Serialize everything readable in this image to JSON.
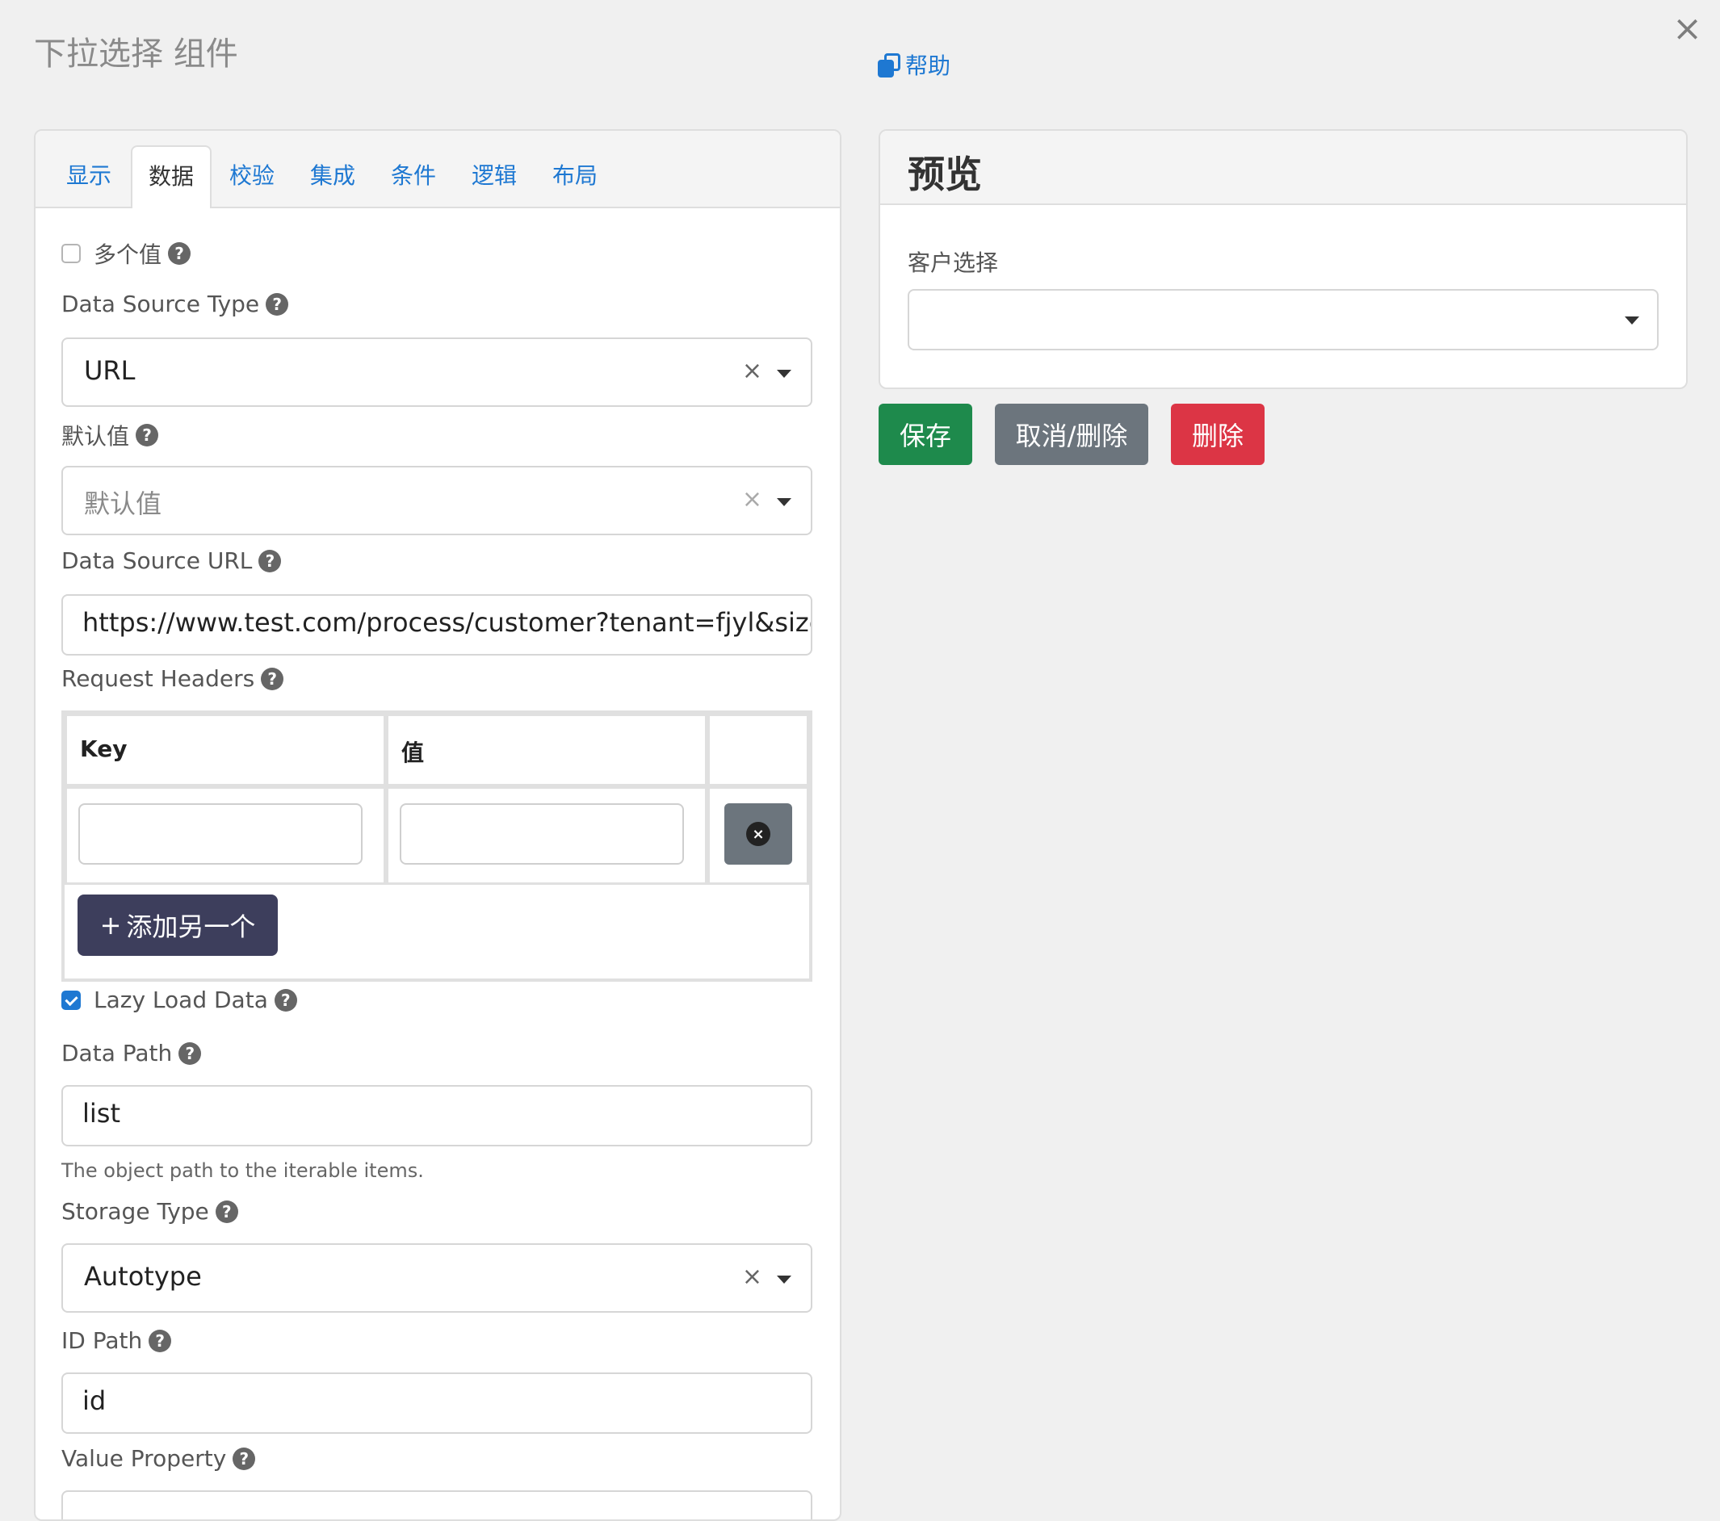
{
  "dialog": {
    "title": "下拉选择 组件",
    "help_label": "帮助",
    "close_glyph": "×"
  },
  "tabs": [
    "显示",
    "数据",
    "校验",
    "集成",
    "条件",
    "逻辑",
    "布局"
  ],
  "active_tab": "数据",
  "form": {
    "multiple_values": {
      "label": "多个值",
      "checked": false
    },
    "data_source_type": {
      "label": "Data Source Type",
      "value": "URL"
    },
    "default_value": {
      "label": "默认值",
      "placeholder": "默认值"
    },
    "data_source_url": {
      "label": "Data Source URL",
      "value": "https://www.test.com/process/customer?tenant=fjyl&size={{limi"
    },
    "request_headers": {
      "label": "Request Headers",
      "col_key": "Key",
      "col_value": "值",
      "add_label": "添加另一个",
      "add_icon": "+",
      "remove_glyph": "×"
    },
    "lazy_load": {
      "label": "Lazy Load Data",
      "checked": true
    },
    "data_path": {
      "label": "Data Path",
      "value": "list",
      "hint": "The object path to the iterable items."
    },
    "storage_type": {
      "label": "Storage Type",
      "value": "Autotype"
    },
    "id_path": {
      "label": "ID Path",
      "value": "id"
    },
    "value_property": {
      "label": "Value Property"
    }
  },
  "preview": {
    "title": "预览",
    "field_label": "客户选择"
  },
  "actions": {
    "save": "保存",
    "cancel": "取消/删除",
    "delete": "删除"
  },
  "help_glyph": "?",
  "clear_glyph": "×",
  "colors": {
    "link": "#1e78d2",
    "save": "#1e8a4c",
    "cancel": "#6c757d",
    "delete": "#dc3545",
    "add_button": "#3d3e5c"
  }
}
